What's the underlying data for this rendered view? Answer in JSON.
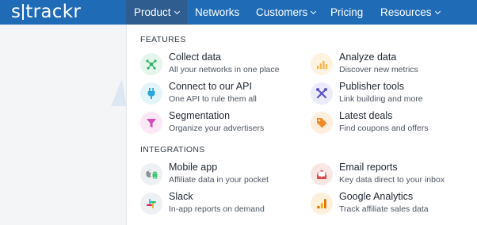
{
  "header": {
    "logo_left": "s",
    "logo_right": "trackr",
    "nav": [
      {
        "label": "Product",
        "dropdown": true,
        "active": true
      },
      {
        "label": "Networks",
        "dropdown": false
      },
      {
        "label": "Customers",
        "dropdown": true
      },
      {
        "label": "Pricing",
        "dropdown": false
      },
      {
        "label": "Resources",
        "dropdown": true
      }
    ]
  },
  "menu": {
    "features_title": "FEATURES",
    "integrations_title": "INTEGRATIONS",
    "features": [
      {
        "title": "Collect data",
        "subtitle": "All your networks in one place",
        "icon": "network-nodes-icon"
      },
      {
        "title": "Analyze data",
        "subtitle": "Discover new metrics",
        "icon": "bar-chart-icon"
      },
      {
        "title": "Connect to our API",
        "subtitle": "One API to rule them all",
        "icon": "plug-icon"
      },
      {
        "title": "Publisher tools",
        "subtitle": "Link building and more",
        "icon": "tools-icon"
      },
      {
        "title": "Segmentation",
        "subtitle": "Organize your advertisers",
        "icon": "funnel-icon"
      },
      {
        "title": "Latest deals",
        "subtitle": "Find coupons and offers",
        "icon": "tag-icon"
      }
    ],
    "integrations": [
      {
        "title": "Mobile app",
        "subtitle": "Affiliate data in your pocket",
        "icon": "apple-android-icon"
      },
      {
        "title": "Email reports",
        "subtitle": "Key data direct to your inbox",
        "icon": "email-icon"
      },
      {
        "title": "Slack",
        "subtitle": "In-app reports on demand",
        "icon": "slack-icon"
      },
      {
        "title": "Google Analytics",
        "subtitle": "Track affiliate sales data",
        "icon": "google-analytics-icon"
      }
    ]
  },
  "colors": {
    "header_bg": "#1f6bb6",
    "active_nav_bg": "#2f5d8f"
  }
}
